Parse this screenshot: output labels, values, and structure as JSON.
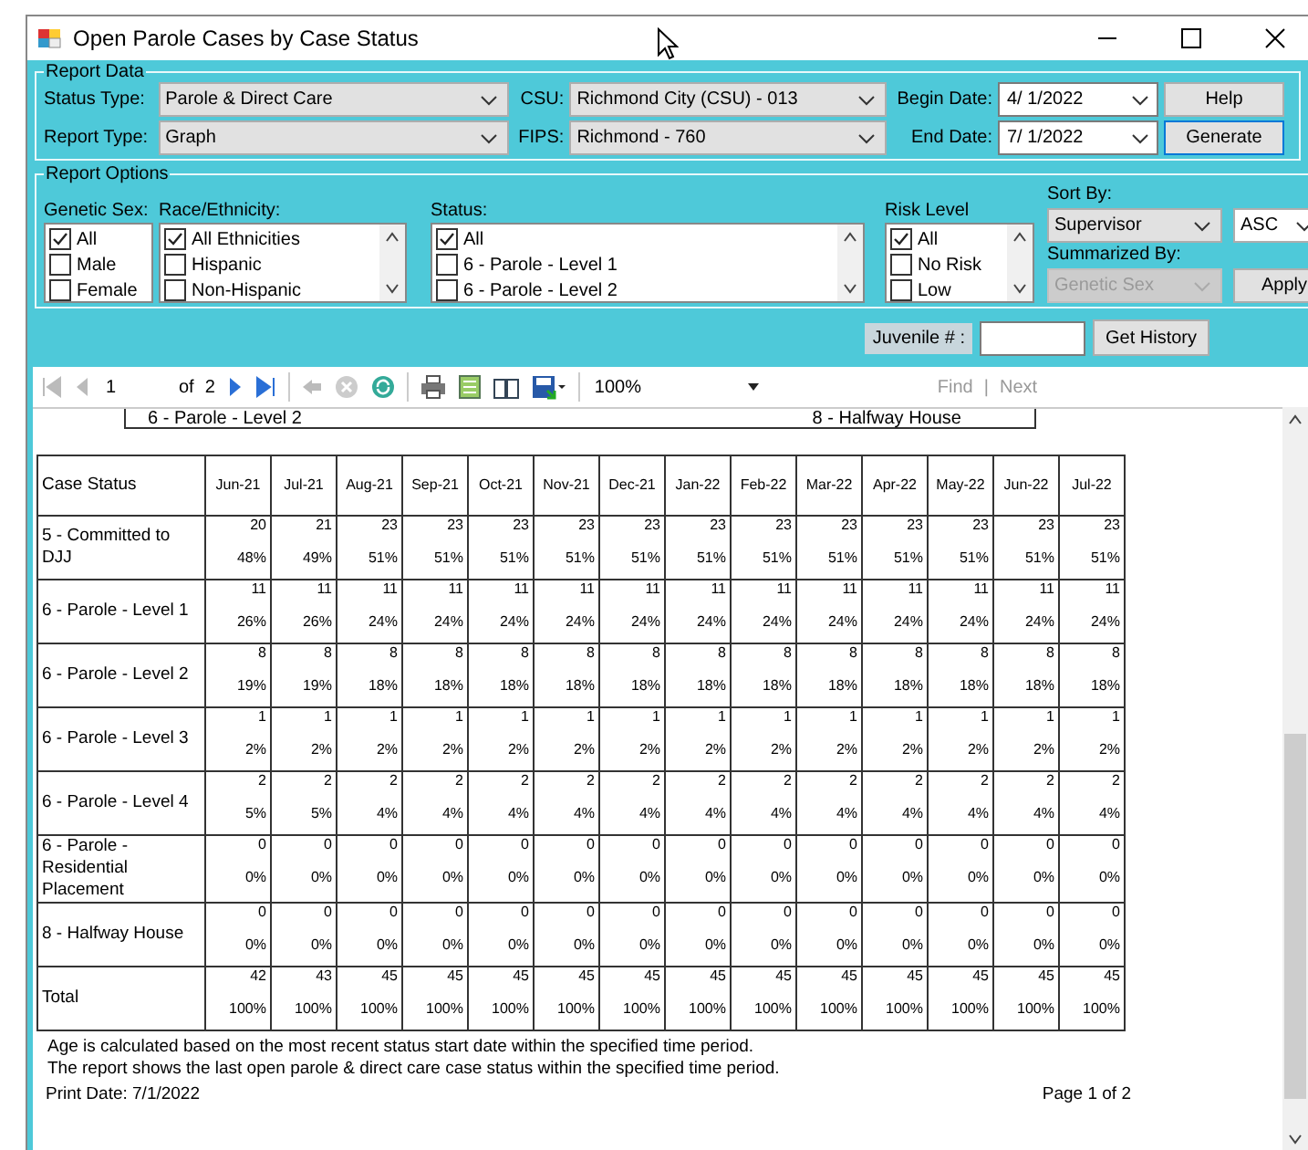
{
  "window": {
    "title": "Open Parole Cases by Case Status"
  },
  "report_data": {
    "legend": "Report Data",
    "fields": [
      {
        "label": "Status Type:",
        "value": "Parole & Direct Care"
      },
      {
        "label": "CSU:",
        "value": "Richmond City (CSU) - 013"
      },
      {
        "label": "Report Type:",
        "value": "Graph"
      },
      {
        "label": "FIPS:",
        "value": "Richmond - 760"
      }
    ],
    "dates": [
      {
        "label": "Begin Date:",
        "value": "4/  1/2022"
      },
      {
        "label": "End Date:",
        "value": "7/  1/2022"
      }
    ],
    "buttons": [
      "Help",
      "Generate"
    ]
  },
  "report_options": {
    "legend": "Report Options",
    "lists": [
      {
        "label": "Genetic Sex:",
        "scroll": false,
        "items": [
          {
            "label": "All",
            "checked": true
          },
          {
            "label": "Male",
            "checked": false
          },
          {
            "label": "Female",
            "checked": false
          }
        ]
      },
      {
        "label": "Race/Ethnicity:",
        "scroll": true,
        "items": [
          {
            "label": "All Ethnicities",
            "checked": true
          },
          {
            "label": "Hispanic",
            "checked": false
          },
          {
            "label": "Non-Hispanic",
            "checked": false
          }
        ]
      },
      {
        "label": "Status:",
        "scroll": true,
        "items": [
          {
            "label": "All",
            "checked": true
          },
          {
            "label": "6 - Parole - Level 1",
            "checked": false
          },
          {
            "label": "6 - Parole - Level 2",
            "checked": false
          }
        ]
      },
      {
        "label": "Risk Level",
        "scroll": true,
        "items": [
          {
            "label": "All",
            "checked": true
          },
          {
            "label": "No Risk",
            "checked": false
          },
          {
            "label": "Low",
            "checked": false
          }
        ]
      }
    ],
    "sort_by": {
      "label": "Sort By:",
      "value": "Supervisor",
      "order": "ASC"
    },
    "summarized_by": {
      "label": "Summarized By:",
      "value": "Genetic Sex",
      "disabled": true
    },
    "apply": "Apply"
  },
  "juvenile": {
    "label": "Juvenile # :",
    "button": "Get History"
  },
  "toolbar": {
    "page": "1",
    "of": "of",
    "total": "2",
    "zoom": "100%",
    "find": "Find",
    "separator": "|",
    "next": "Next"
  },
  "report": {
    "header_items": [
      "6 - Parole - Level 2",
      "8 - Halfway House"
    ],
    "columns": [
      "Case Status",
      "Jun-21",
      "Jul-21",
      "Aug-21",
      "Sep-21",
      "Oct-21",
      "Nov-21",
      "Dec-21",
      "Jan-22",
      "Feb-22",
      "Mar-22",
      "Apr-22",
      "May-22",
      "Jun-22",
      "Jul-22"
    ],
    "rows": [
      {
        "label": "5 - Committed to DJJ",
        "counts": [
          "20",
          "21",
          "23",
          "23",
          "23",
          "23",
          "23",
          "23",
          "23",
          "23",
          "23",
          "23",
          "23",
          "23"
        ],
        "percents": [
          "48%",
          "49%",
          "51%",
          "51%",
          "51%",
          "51%",
          "51%",
          "51%",
          "51%",
          "51%",
          "51%",
          "51%",
          "51%",
          "51%"
        ]
      },
      {
        "label": "6 - Parole - Level 1",
        "counts": [
          "11",
          "11",
          "11",
          "11",
          "11",
          "11",
          "11",
          "11",
          "11",
          "11",
          "11",
          "11",
          "11",
          "11"
        ],
        "percents": [
          "26%",
          "26%",
          "24%",
          "24%",
          "24%",
          "24%",
          "24%",
          "24%",
          "24%",
          "24%",
          "24%",
          "24%",
          "24%",
          "24%"
        ]
      },
      {
        "label": "6 - Parole - Level 2",
        "counts": [
          "8",
          "8",
          "8",
          "8",
          "8",
          "8",
          "8",
          "8",
          "8",
          "8",
          "8",
          "8",
          "8",
          "8"
        ],
        "percents": [
          "19%",
          "19%",
          "18%",
          "18%",
          "18%",
          "18%",
          "18%",
          "18%",
          "18%",
          "18%",
          "18%",
          "18%",
          "18%",
          "18%"
        ]
      },
      {
        "label": "6 - Parole - Level 3",
        "counts": [
          "1",
          "1",
          "1",
          "1",
          "1",
          "1",
          "1",
          "1",
          "1",
          "1",
          "1",
          "1",
          "1",
          "1"
        ],
        "percents": [
          "2%",
          "2%",
          "2%",
          "2%",
          "2%",
          "2%",
          "2%",
          "2%",
          "2%",
          "2%",
          "2%",
          "2%",
          "2%",
          "2%"
        ]
      },
      {
        "label": "6 - Parole - Level 4",
        "counts": [
          "2",
          "2",
          "2",
          "2",
          "2",
          "2",
          "2",
          "2",
          "2",
          "2",
          "2",
          "2",
          "2",
          "2"
        ],
        "percents": [
          "5%",
          "5%",
          "4%",
          "4%",
          "4%",
          "4%",
          "4%",
          "4%",
          "4%",
          "4%",
          "4%",
          "4%",
          "4%",
          "4%"
        ]
      },
      {
        "label": "6 - Parole - Residential Placement",
        "counts": [
          "0",
          "0",
          "0",
          "0",
          "0",
          "0",
          "0",
          "0",
          "0",
          "0",
          "0",
          "0",
          "0",
          "0"
        ],
        "percents": [
          "0%",
          "0%",
          "0%",
          "0%",
          "0%",
          "0%",
          "0%",
          "0%",
          "0%",
          "0%",
          "0%",
          "0%",
          "0%",
          "0%"
        ]
      },
      {
        "label": "8 - Halfway House",
        "counts": [
          "0",
          "0",
          "0",
          "0",
          "0",
          "0",
          "0",
          "0",
          "0",
          "0",
          "0",
          "0",
          "0",
          "0"
        ],
        "percents": [
          "0%",
          "0%",
          "0%",
          "0%",
          "0%",
          "0%",
          "0%",
          "0%",
          "0%",
          "0%",
          "0%",
          "0%",
          "0%",
          "0%"
        ]
      },
      {
        "label": "Total",
        "counts": [
          "42",
          "43",
          "45",
          "45",
          "45",
          "45",
          "45",
          "45",
          "45",
          "45",
          "45",
          "45",
          "45",
          "45"
        ],
        "percents": [
          "100%",
          "100%",
          "100%",
          "100%",
          "100%",
          "100%",
          "100%",
          "100%",
          "100%",
          "100%",
          "100%",
          "100%",
          "100%",
          "100%"
        ]
      }
    ],
    "notes": [
      "Age is calculated based on the most recent status start date within the specified time period.",
      "The report shows the last open parole & direct care case status within the specified time period."
    ],
    "print_date": "Print Date: 7/1/2022",
    "page": "Page 1 of 2"
  }
}
